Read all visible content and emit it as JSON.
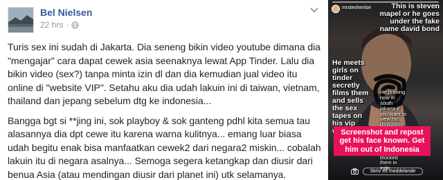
{
  "post": {
    "author": "Bel Nielsen",
    "timestamp": "22 hrs",
    "separator": "·",
    "icons": {
      "privacy": "globe-icon",
      "menu": "chevron-down-icon"
    },
    "paragraphs": [
      "Turis sex ini sudah di Jakarta. Dia seneng bikin video youtube dimana dia \"mengajar\" cara dapat cewek asia seenaknya lewat App Tinder. Lalu dia bikin video (sex?) tanpa minta izin dl dan dia kemudian jual video itu online di \"website VIP\". Setahu aku dia udah lakuin ini di taiwan, vietnam, thailand dan jepang sebelum dtg ke indonesia...",
      "Bangga bgt si **jing ini, sok playboy & sok ganteng pdhl kita semua tau alasannya dia dpt cewe itu karena warna kulitnya... emang luar biasa udah begitu enak bisa manfaatkan cewek2 dari negara2 miskin... cobalah lakuin itu di negara asalnya... Semoga segera ketangkap dan diusir dari benua Asia (atau mendingan diusir dari planet ini) utk selamanya."
    ]
  },
  "story": {
    "username": "mrsteohenlse",
    "caption_top": "This is steven mapel or he goes under the fake name david bond",
    "caption_left": "He meets girls on tinder secretly films them and sells the sex tapes on his vip website.",
    "caption_small": "He is living now in south jakarta if you want to view his disgusting videos on YouTube you need to use a vpn as he has blocked them in indo.",
    "pink_box": "Screenshot and repost get his face known. Get him out of Indonesia",
    "reply_placeholder": "Skriv ett meddelande",
    "icons": {
      "camera": "camera-icon",
      "close": "close-icon"
    },
    "colors": {
      "pink": "#e8125c",
      "link": "#365899"
    }
  }
}
